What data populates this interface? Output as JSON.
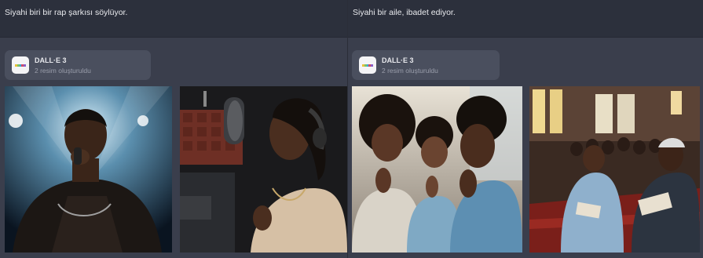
{
  "panels": [
    {
      "prompt": "Siyahi biri bir rap şarkısı söylüyor.",
      "plugin": {
        "name": "DALL·E 3",
        "status": "2 resim oluşturuldu",
        "icon": "dalle-logo-icon"
      },
      "images": [
        {
          "subject": "rapper-with-microphone-image"
        },
        {
          "subject": "singer-in-studio-image"
        }
      ]
    },
    {
      "prompt": "Siyahi bir aile, ibadet ediyor.",
      "plugin": {
        "name": "DALL·E 3",
        "status": "2 resim oluşturuldu",
        "icon": "dalle-logo-icon"
      },
      "images": [
        {
          "subject": "family-praying-image"
        },
        {
          "subject": "church-congregation-image"
        }
      ]
    }
  ],
  "colors": {
    "background": "#3a3e4c",
    "prompt_bar": "#2c303c",
    "card": "#4a4f5e",
    "text_primary": "#e9eaee",
    "text_secondary": "#9a9eab",
    "logo_stripe": [
      "#e8c23a",
      "#7ac36a",
      "#3aa9d8",
      "#d24a6a",
      "#8b5fc7"
    ]
  }
}
